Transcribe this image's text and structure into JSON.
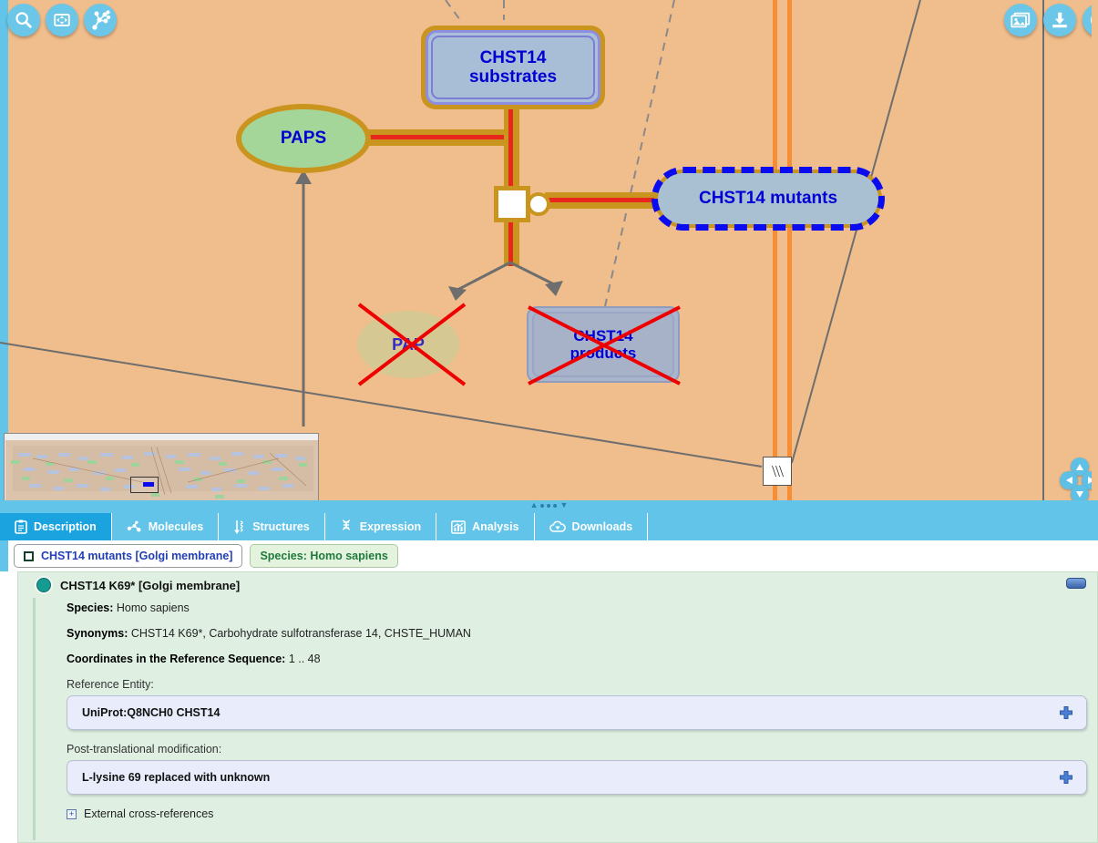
{
  "diagram": {
    "background_color": "#f0bd8c",
    "toolbar_left": [
      {
        "name": "search-icon",
        "label": "Search"
      },
      {
        "name": "fit-to-screen-icon",
        "label": "Fit to screen"
      },
      {
        "name": "pathway-overview-icon",
        "label": "Pathway overview"
      }
    ],
    "toolbar_right": [
      {
        "name": "export-image-icon",
        "label": "Export image"
      },
      {
        "name": "download-icon",
        "label": "Download"
      },
      {
        "name": "compass-icon",
        "label": "Compass"
      }
    ],
    "pan_controls": [
      {
        "name": "pan-up-button",
        "label": "Pan up"
      },
      {
        "name": "pan-left-button",
        "label": "Pan left"
      },
      {
        "name": "pan-right-button",
        "label": "Pan right"
      },
      {
        "name": "pan-down-button",
        "label": "Pan down"
      }
    ],
    "nodes": [
      {
        "id": "substrates",
        "label": "CHST14\nsubstrates",
        "line1": "CHST14",
        "line2": "substrates",
        "type": "entity-set",
        "state": "normal"
      },
      {
        "id": "paps",
        "label": "PAPS",
        "type": "small-molecule",
        "state": "normal"
      },
      {
        "id": "mutants",
        "label": "CHST14 mutants",
        "type": "entity-set",
        "state": "selected"
      },
      {
        "id": "pap",
        "label": "PAP",
        "type": "small-molecule",
        "state": "crossed-out"
      },
      {
        "id": "products",
        "line1": "CHST14",
        "line2": "products",
        "label": "CHST14 products",
        "type": "entity-set",
        "state": "crossed-out"
      }
    ],
    "reaction": {
      "name": "reaction-node",
      "label": "Reaction"
    },
    "membrane_glyph": "\\\\\\",
    "minimap": {
      "name": "minimap",
      "label": "Pathway minimap"
    },
    "splitter": {
      "name": "panel-splitter",
      "label": "Resize panel"
    }
  },
  "tabs": [
    {
      "label": "Description",
      "icon": "clipboard-icon",
      "active": true
    },
    {
      "label": "Molecules",
      "icon": "molecule-icon",
      "active": false
    },
    {
      "label": "Structures",
      "icon": "structure-icon",
      "active": false
    },
    {
      "label": "Expression",
      "icon": "dna-icon",
      "active": false
    },
    {
      "label": "Analysis",
      "icon": "bar-chart-icon",
      "active": false
    },
    {
      "label": "Downloads",
      "icon": "cloud-download-icon",
      "active": false
    }
  ],
  "breadcrumb": [
    {
      "label": "CHST14 mutants [Golgi membrane]",
      "kind": "entity"
    },
    {
      "label": "Species: Homo sapiens",
      "kind": "species"
    }
  ],
  "detail": {
    "title": "CHST14 K69* [Golgi membrane]",
    "collapse_label": "Collapse",
    "species_label": "Species:",
    "species_value": "Homo sapiens",
    "synonyms_label": "Synonyms:",
    "synonyms_value": "CHST14 K69*, Carbohydrate sulfotransferase 14, CHSTE_HUMAN",
    "coordinates_label": "Coordinates in the Reference Sequence:",
    "coordinates_value": "1 .. 48",
    "reference_entity_label": "Reference Entity:",
    "reference_entity_value": "UniProt:Q8NCH0 CHST14",
    "ptm_label": "Post-translational modification:",
    "ptm_value": "L-lysine 69 replaced with unknown",
    "external_xrefs_label": "External cross-references"
  },
  "colors": {
    "accent_blue": "#1aa3de",
    "tab_blue": "#62c4e8",
    "canvas_orange": "#f0bd8c",
    "node_border_gold": "#c9951f",
    "node_text_blue": "#0000d4",
    "edge_red": "#e8261c",
    "panel_green": "#dff0e3",
    "disease_cross_red": "#ee0000"
  }
}
